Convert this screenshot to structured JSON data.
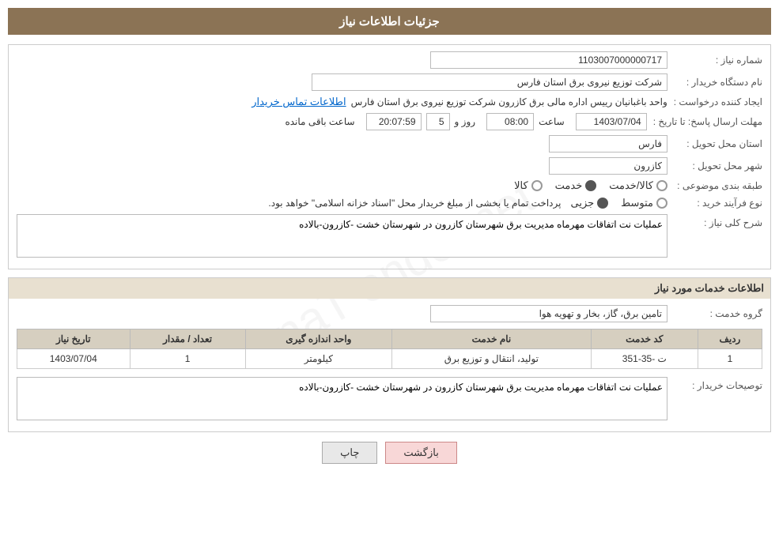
{
  "header": {
    "title": "جزئیات اطلاعات نیاز"
  },
  "fields": {
    "shomare_niaz_label": "شماره نیاز :",
    "shomare_niaz_value": "1103007000000717",
    "nam_dastgah_label": "نام دستگاه خریدار :",
    "nam_dastgah_value": "شرکت توزیع نیروی برق استان فارس",
    "ijad_konande_label": "ایجاد کننده درخواست :",
    "ijad_konande_part1": "واحد باغبانیان رییس اداره مالی برق کازرون شرکت توزیع نیروی برق استان فارس",
    "ijad_konande_link": "اطلاعات تماس خریدار",
    "mohlat_label": "مهلت ارسال پاسخ: تا تاریخ :",
    "mohlat_date": "1403/07/04",
    "mohlat_saat_label": "ساعت",
    "mohlat_saat_value": "08:00",
    "mohlat_roz_label": "روز و",
    "mohlat_roz_value": "5",
    "mohlat_time_value": "20:07:59",
    "mohlat_remaining_label": "ساعت باقی مانده",
    "ostan_label": "استان محل تحویل :",
    "ostan_value": "فارس",
    "shahr_label": "شهر محل تحویل :",
    "shahr_value": "کازرون",
    "tabaqe_label": "طبقه بندی موضوعی :",
    "tabaqe_kala": "کالا",
    "tabaqe_khedmat": "خدمت",
    "tabaqe_kala_khedmat": "کالا/خدمت",
    "tabaqe_selected": "khedmat",
    "noe_farayand_label": "نوع فرآیند خرید :",
    "noe_jozyi": "جزیی",
    "noe_motevasset": "متوسط",
    "noe_text": "پرداخت تمام یا بخشی از مبلغ خریدار محل \"اسناد خزانه اسلامی\" خواهد بود.",
    "sharh_label": "شرح کلی نیاز :",
    "sharh_value": "عملیات نت اتفاقات مهرماه مدیریت برق شهرستان کازرون در شهرستان خشت -کازرون-بالاده",
    "service_section": "اطلاعات خدمات مورد نیاز",
    "group_label": "گروه خدمت :",
    "group_value": "تامین برق، گاز، بخار و تهویه هوا",
    "table": {
      "headers": [
        "ردیف",
        "کد خدمت",
        "نام خدمت",
        "واحد اندازه گیری",
        "تعداد / مقدار",
        "تاریخ نیاز"
      ],
      "rows": [
        {
          "radif": "1",
          "kod_khedmat": "ت -35-351",
          "nam_khedmat": "تولید، انتقال و توزیع برق",
          "vahed": "کیلومتر",
          "tedad": "1",
          "tarikh": "1403/07/04"
        }
      ]
    },
    "tosif_label": "توصیحات خریدار :",
    "tosif_value": "عملیات نت اتفاقات مهرماه مدیریت برق شهرستان کازرون در شهرستان خشت -کازرون-بالاده"
  },
  "buttons": {
    "back_label": "بازگشت",
    "print_label": "چاپ"
  }
}
